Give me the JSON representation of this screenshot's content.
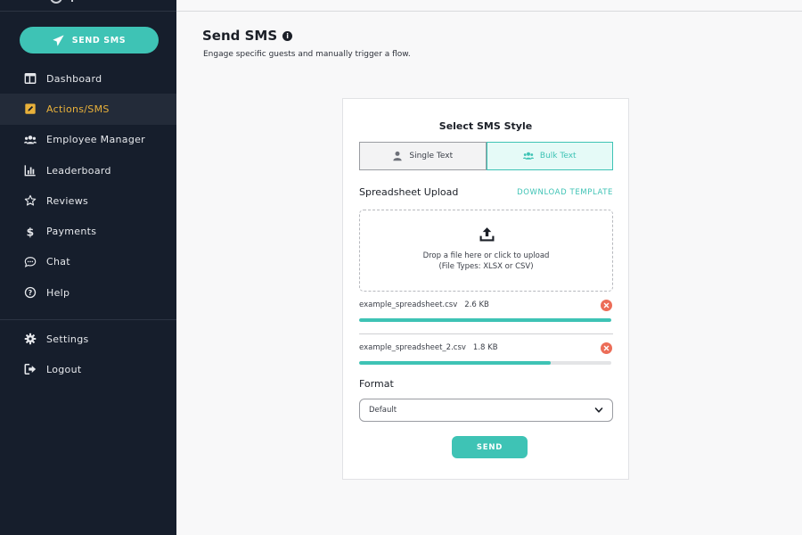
{
  "sidebar": {
    "cta_label": "SEND SMS",
    "nav": [
      {
        "label": "Dashboard",
        "icon": "dashboard-icon"
      },
      {
        "label": "Actions/SMS",
        "icon": "edit-icon",
        "active": true
      },
      {
        "label": "Employee Manager",
        "icon": "users-icon"
      },
      {
        "label": "Leaderboard",
        "icon": "bar-chart-icon"
      },
      {
        "label": "Reviews",
        "icon": "star-icon"
      },
      {
        "label": "Payments",
        "icon": "dollar-icon"
      },
      {
        "label": "Chat",
        "icon": "chat-icon"
      },
      {
        "label": "Help",
        "icon": "help-icon"
      }
    ],
    "nav_bottom": [
      {
        "label": "Settings",
        "icon": "gear-icon"
      },
      {
        "label": "Logout",
        "icon": "logout-icon"
      }
    ]
  },
  "page": {
    "title": "Send SMS",
    "subtitle": "Engage specific guests and manually trigger a flow."
  },
  "card": {
    "title": "Select SMS Style",
    "options": {
      "single": "Single Text",
      "bulk": "Bulk Text",
      "selected": "bulk"
    },
    "upload": {
      "title": "Spreadsheet Upload",
      "download_label": "DOWNLOAD TEMPLATE",
      "drop_text": "Drop a file here or click to upload",
      "file_types": "(File Types: XLSX or CSV)"
    },
    "files": [
      {
        "name": "example_spreadsheet.csv",
        "size": "2.6 KB",
        "progress": 1.0
      },
      {
        "name": "example_spreadsheet_2.csv",
        "size": "1.8 KB",
        "progress": 0.76
      }
    ],
    "format": {
      "label": "Format",
      "value": "Default"
    },
    "send_label": "SEND"
  },
  "colors": {
    "accent": "#3ec3b5",
    "sidebar_bg": "#161e2c",
    "active_nav": "#e9b13a",
    "danger": "#ec6d58"
  }
}
